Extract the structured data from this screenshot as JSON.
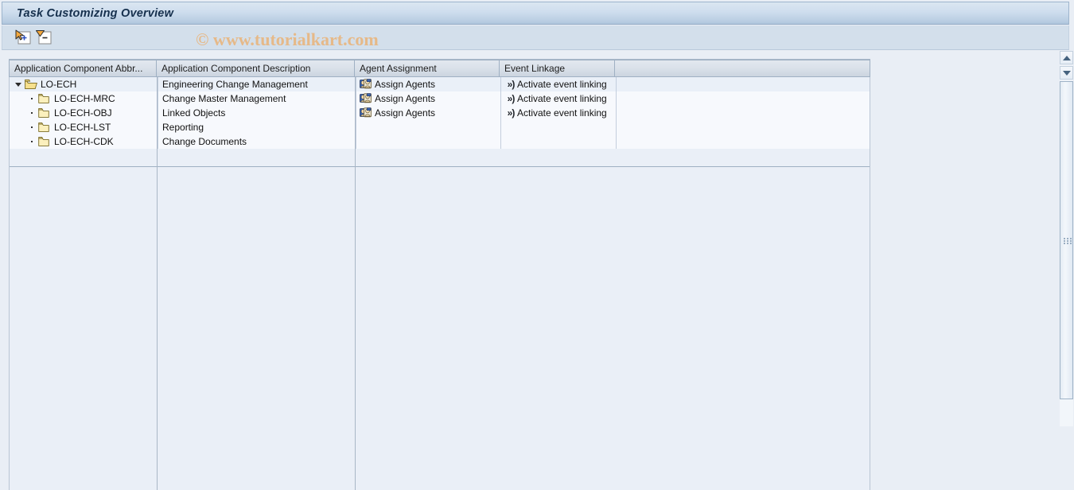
{
  "window": {
    "title": "Task Customizing Overview"
  },
  "toolbar": {
    "buttons": [
      {
        "name": "expand-all-button",
        "title": "Expand All",
        "icon": "expand-node-icon"
      },
      {
        "name": "collapse-all-button",
        "title": "Collapse All",
        "icon": "collapse-node-icon"
      }
    ]
  },
  "watermark": {
    "text": "© www.tutorialkart.com",
    "color": "#e6b988"
  },
  "table": {
    "columns": [
      {
        "label": "Application Component Abbr...",
        "name": "col-application-component-abbr"
      },
      {
        "label": "Application Component Description",
        "name": "col-application-component-description"
      },
      {
        "label": "Agent Assignment",
        "name": "col-agent-assignment"
      },
      {
        "label": "Event Linkage",
        "name": "col-event-linkage"
      },
      {
        "label": "",
        "name": "col-spacer"
      }
    ],
    "rows": [
      {
        "abbr": "LO-ECH",
        "description": "Engineering Change Management",
        "agent_assignment": "Assign Agents",
        "event_linkage": "Activate event linking",
        "level": 0,
        "expanded": true,
        "folder": "folder-open-icon"
      },
      {
        "abbr": "LO-ECH-MRC",
        "description": "Change Master Management",
        "agent_assignment": "Assign Agents",
        "event_linkage": "Activate event linking",
        "level": 1,
        "expanded": false,
        "folder": "folder-closed-icon"
      },
      {
        "abbr": "LO-ECH-OBJ",
        "description": "Linked Objects",
        "agent_assignment": "Assign Agents",
        "event_linkage": "Activate event linking",
        "level": 1,
        "expanded": false,
        "folder": "folder-closed-icon"
      },
      {
        "abbr": "LO-ECH-LST",
        "description": "Reporting",
        "agent_assignment": "",
        "event_linkage": "",
        "level": 1,
        "expanded": false,
        "folder": "folder-closed-icon"
      },
      {
        "abbr": "LO-ECH-CDK",
        "description": "Change Documents",
        "agent_assignment": "",
        "event_linkage": "",
        "level": 1,
        "expanded": false,
        "folder": "folder-closed-icon"
      }
    ]
  },
  "scrollbar": {
    "up_label": "scroll-up",
    "down_label": "scroll-down"
  },
  "colors": {
    "title_text": "#16304d",
    "titlebar_top": "#dbe6f1",
    "titlebar_bottom": "#aec5dc",
    "toolbar_bg": "#d3dfeb",
    "grid_bg": "#eaeff7",
    "folder_yellow": "#f7e08f"
  }
}
